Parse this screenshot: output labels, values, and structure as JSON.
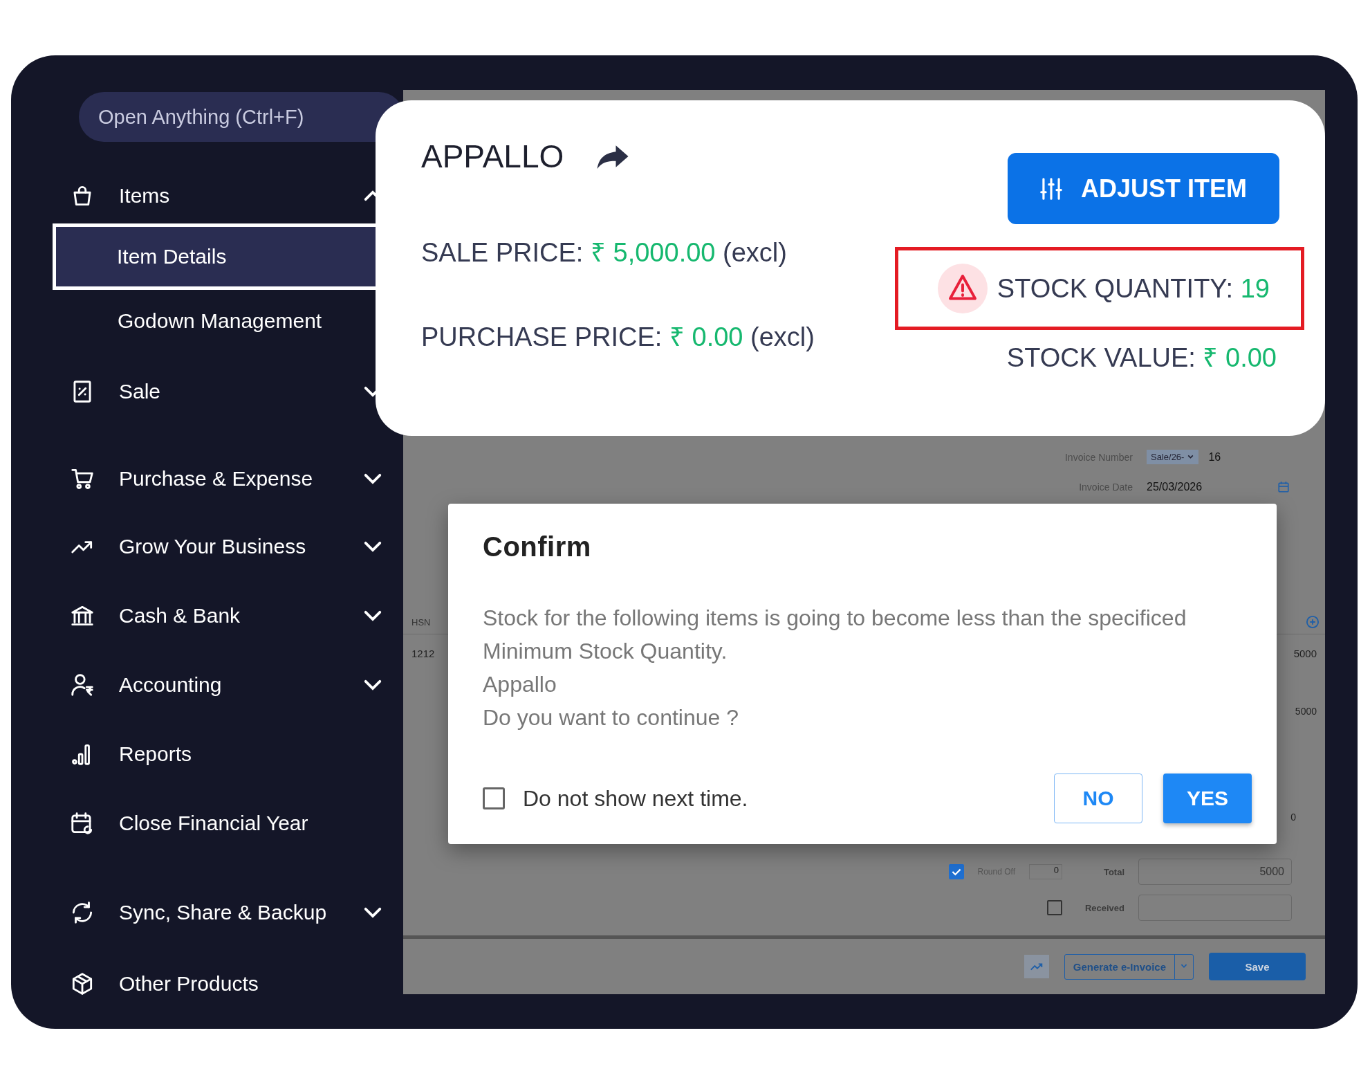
{
  "sidebar": {
    "search": {
      "placeholder": "Open Anything (Ctrl+F)"
    },
    "items": [
      {
        "label": "Items",
        "expanded": true,
        "children": [
          {
            "label": "Item Details",
            "selected": true
          },
          {
            "label": "Godown Management",
            "selected": false
          }
        ]
      },
      {
        "label": "Sale",
        "expanded": false
      },
      {
        "label": "Purchase & Expense",
        "expanded": false
      },
      {
        "label": "Grow Your Business",
        "expanded": false
      },
      {
        "label": "Cash & Bank",
        "expanded": false
      },
      {
        "label": "Accounting",
        "expanded": false
      },
      {
        "label": "Reports"
      },
      {
        "label": "Close Financial Year"
      },
      {
        "label": "Sync, Share & Backup",
        "expanded": false
      },
      {
        "label": "Other Products"
      }
    ]
  },
  "invoice": {
    "number_label": "Invoice Number",
    "series": "Sale/26-",
    "number": "16",
    "date_label": "Invoice Date",
    "date": "25/03/2026",
    "column_1": "HSN",
    "row_cells": [
      "1212",
      "5000"
    ],
    "subtotal": "5000",
    "row_3_value": "0",
    "round_off": {
      "label": "Round Off",
      "checked": true,
      "value": "0"
    },
    "total": {
      "label": "Total",
      "value": "5000"
    },
    "received": {
      "label": "Received",
      "checked": false
    },
    "e_invoice_button": "Generate e-Invoice",
    "save_button": "Save"
  },
  "item_card": {
    "title": "APPALLO",
    "adjust_button": "ADJUST ITEM",
    "sale_price": {
      "label": "SALE PRICE:",
      "value": "₹ 5,000.00",
      "suffix": "(excl)"
    },
    "purchase_price": {
      "label": "PURCHASE PRICE:",
      "value": "₹ 0.00",
      "suffix": "(excl)"
    },
    "stock_quantity": {
      "label": "STOCK QUANTITY:",
      "value": "19",
      "warning": true
    },
    "stock_value": {
      "label": "STOCK VALUE:",
      "value": "₹ 0.00"
    }
  },
  "dialog": {
    "title": "Confirm",
    "lines": [
      "Stock for the following items is going to become less than the specificed",
      "Minimum Stock Quantity.",
      "Appallo",
      "Do you want to continue ?"
    ],
    "checkbox": {
      "label": "Do not show next time.",
      "checked": false
    },
    "buttons": [
      {
        "label": "NO",
        "kind": "secondary"
      },
      {
        "label": "YES",
        "kind": "primary"
      }
    ]
  }
}
